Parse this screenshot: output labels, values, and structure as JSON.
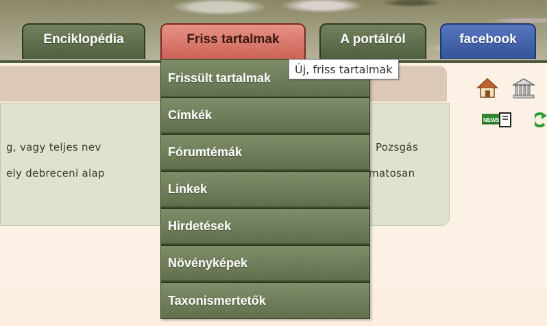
{
  "nav": {
    "tabs": [
      {
        "label": "Enciklopédia"
      },
      {
        "label": "Friss tartalmak"
      },
      {
        "label": "A portálról"
      },
      {
        "label": "facebook"
      }
    ]
  },
  "dropdown": {
    "items": [
      {
        "label": "Frissült tartalmak"
      },
      {
        "label": "Címkék"
      },
      {
        "label": "Fórumtémák"
      },
      {
        "label": "Linkek"
      },
      {
        "label": "Hirdetések"
      },
      {
        "label": "Növényképek"
      },
      {
        "label": "Taxonismertetők"
      }
    ]
  },
  "tooltip": {
    "text": "Új, friss tartalmak"
  },
  "content": {
    "left_line_1": "g,  vagy  teljes  nev",
    "left_line_2": "ely  debreceni  alap",
    "right_line_1": "Pozsgás",
    "right_line_2": "matosan"
  },
  "icons": {
    "news_label": "NEWS",
    "home": "home-icon",
    "museum": "museum-icon",
    "refresh": "refresh-icon"
  },
  "colors": {
    "tab_green": "#4b5a3a",
    "tab_active": "#c6564a",
    "tab_facebook": "#34539a"
  }
}
